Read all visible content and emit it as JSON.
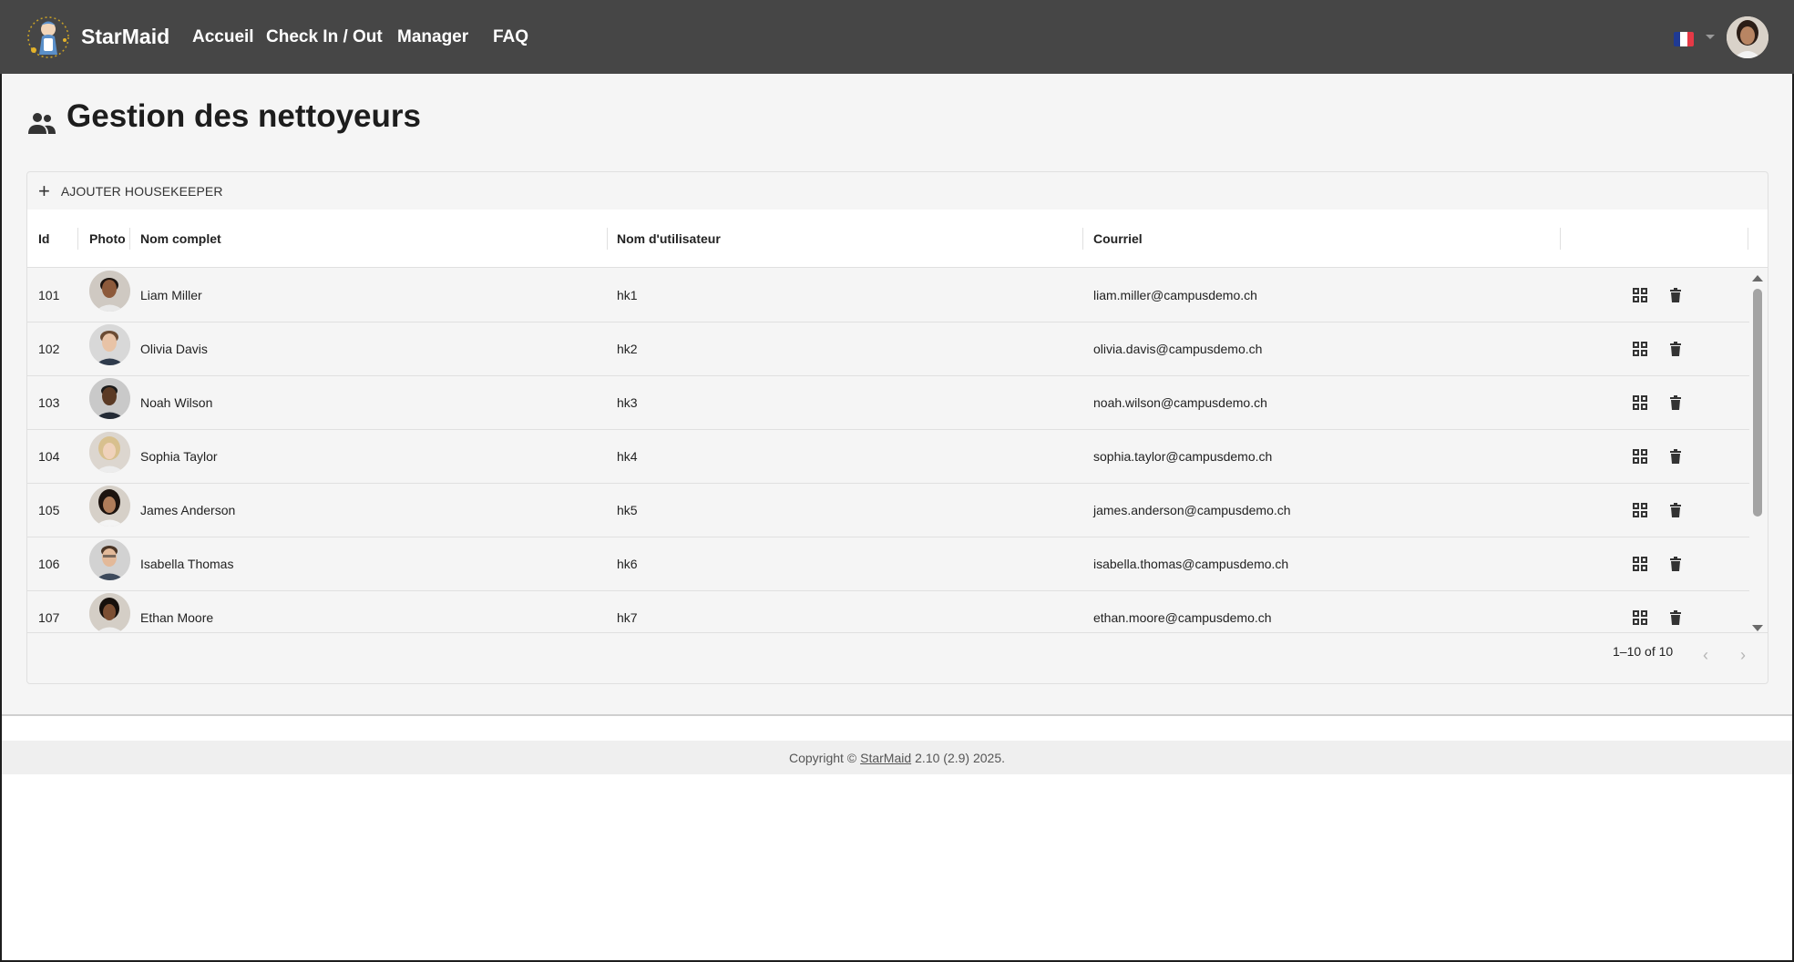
{
  "nav": {
    "brand": "StarMaid",
    "links": [
      "Accueil",
      "Check In / Out",
      "Manager",
      "FAQ"
    ],
    "language": "French"
  },
  "page": {
    "title": "Gestion des nettoyeurs",
    "icon": "people-icon"
  },
  "toolbar": {
    "add_label": "AJOUTER HOUSEKEEPER"
  },
  "table": {
    "columns": [
      "Id",
      "Photo",
      "Nom complet",
      "Nom d'utilisateur",
      "Courriel"
    ],
    "rows": [
      {
        "id": "101",
        "name": "Liam Miller",
        "username": "hk1",
        "email": "liam.miller@campusdemo.ch"
      },
      {
        "id": "102",
        "name": "Olivia Davis",
        "username": "hk2",
        "email": "olivia.davis@campusdemo.ch"
      },
      {
        "id": "103",
        "name": "Noah Wilson",
        "username": "hk3",
        "email": "noah.wilson@campusdemo.ch"
      },
      {
        "id": "104",
        "name": "Sophia Taylor",
        "username": "hk4",
        "email": "sophia.taylor@campusdemo.ch"
      },
      {
        "id": "105",
        "name": "James Anderson",
        "username": "hk5",
        "email": "james.anderson@campusdemo.ch"
      },
      {
        "id": "106",
        "name": "Isabella Thomas",
        "username": "hk6",
        "email": "isabella.thomas@campusdemo.ch"
      },
      {
        "id": "107",
        "name": "Ethan Moore",
        "username": "hk7",
        "email": "ethan.moore@campusdemo.ch"
      }
    ],
    "row_actions": [
      "grid-icon",
      "trash-icon"
    ]
  },
  "pagination": {
    "text": "1–10 of 10"
  },
  "footer": {
    "prefix": "Copyright ©",
    "link": "StarMaid",
    "suffix": "2.10 (2.9) 2025."
  },
  "colors": {
    "topbar": "#464646",
    "page_bg": "#f5f5f5",
    "flag_blue": "#1f3a93",
    "flag_white": "#ffffff",
    "flag_red": "#e63946"
  }
}
